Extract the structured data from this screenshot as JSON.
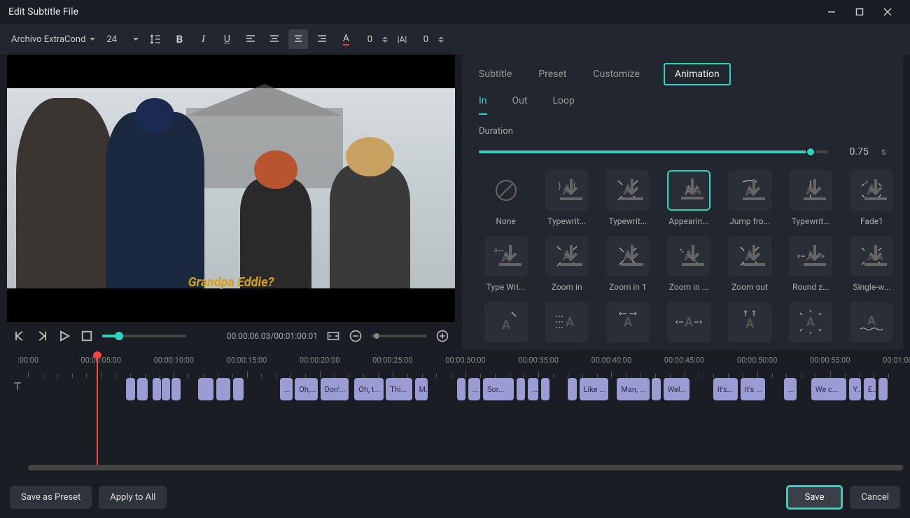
{
  "title": "Edit Subtitle File",
  "toolbar": {
    "font": "Archivo ExtraCond",
    "size": "24",
    "spacing1": "0",
    "spacing2": "0"
  },
  "subtitle_text": "Grandpa Eddie?",
  "timecode": "00:00:06:03/00:01:00:01",
  "tabs": [
    "Subtitle",
    "Preset",
    "Customize",
    "Animation"
  ],
  "active_tab": 3,
  "subtabs": [
    "In",
    "Out",
    "Loop"
  ],
  "active_subtab": 0,
  "duration_label": "Duration",
  "duration_value": "0.75",
  "duration_unit": "s",
  "anims": [
    {
      "label": "None"
    },
    {
      "label": "Typewrit..."
    },
    {
      "label": "Typewrit..."
    },
    {
      "label": "Appearin...",
      "selected": true
    },
    {
      "label": "Jump fro..."
    },
    {
      "label": "Typewrit..."
    },
    {
      "label": "Fade1"
    },
    {
      "label": "Type Wri..."
    },
    {
      "label": "Zoom in"
    },
    {
      "label": "Zoom in 1"
    },
    {
      "label": "Zoom in ..."
    },
    {
      "label": "Zoom out"
    },
    {
      "label": "Round z..."
    },
    {
      "label": "Single-w..."
    },
    {
      "label": ""
    },
    {
      "label": ""
    },
    {
      "label": ""
    },
    {
      "label": ""
    },
    {
      "label": ""
    },
    {
      "label": ""
    },
    {
      "label": ""
    }
  ],
  "ruler": [
    ":00:00",
    "00:00:05:00",
    "00:00:10:00",
    "00:00:15:00",
    "00:00:20:00",
    "00:00:25:00",
    "00:00:30:00",
    "00:00:35:00",
    "00:00:40:00",
    "00:00:45:00",
    "00:00:50:00",
    "00:00:55:00",
    "00:01:00:00"
  ],
  "clips": [
    {
      "left": 11.2,
      "width": 1.0,
      "text": ""
    },
    {
      "left": 12.5,
      "width": 1.2,
      "text": ""
    },
    {
      "left": 14.2,
      "width": 0.8,
      "text": ""
    },
    {
      "left": 15.3,
      "width": 0.8,
      "text": ""
    },
    {
      "left": 16.4,
      "width": 1.0,
      "text": ""
    },
    {
      "left": 19.4,
      "width": 1.8,
      "text": ""
    },
    {
      "left": 21.5,
      "width": 1.6,
      "text": ""
    },
    {
      "left": 23.4,
      "width": 1.2,
      "text": ""
    },
    {
      "left": 28.8,
      "width": 1.4,
      "text": "..."
    },
    {
      "left": 30.5,
      "width": 2.6,
      "text": "Oh,..."
    },
    {
      "left": 33.4,
      "width": 3.2,
      "text": "Don'..."
    },
    {
      "left": 37.3,
      "width": 3.3,
      "text": "Oh, t..."
    },
    {
      "left": 40.9,
      "width": 3.0,
      "text": "Thi..."
    },
    {
      "left": 44.2,
      "width": 1.5,
      "text": "M..."
    },
    {
      "left": 49.0,
      "width": 1.0,
      "text": ""
    },
    {
      "left": 50.3,
      "width": 1.4,
      "text": "..."
    },
    {
      "left": 52.0,
      "width": 3.5,
      "text": "Sor..."
    },
    {
      "left": 55.8,
      "width": 1.0,
      "text": ""
    },
    {
      "left": 57.1,
      "width": 1.2,
      "text": "..."
    },
    {
      "left": 58.6,
      "width": 1.0,
      "text": ""
    },
    {
      "left": 61.7,
      "width": 1.0,
      "text": ""
    },
    {
      "left": 63.0,
      "width": 3.3,
      "text": "Like ..."
    },
    {
      "left": 67.3,
      "width": 3.7,
      "text": "Man, ..."
    },
    {
      "left": 71.3,
      "width": 1.0,
      "text": ""
    },
    {
      "left": 72.6,
      "width": 3.0,
      "text": "Wel..."
    },
    {
      "left": 78.3,
      "width": 2.8,
      "text": "It's..."
    },
    {
      "left": 81.4,
      "width": 2.8,
      "text": "It's ..."
    },
    {
      "left": 86.4,
      "width": 1.4,
      "text": "..."
    },
    {
      "left": 89.5,
      "width": 4.0,
      "text": "We c..."
    },
    {
      "left": 93.8,
      "width": 1.4,
      "text": "Y..."
    },
    {
      "left": 95.5,
      "width": 1.4,
      "text": "E..."
    },
    {
      "left": 97.2,
      "width": 1.0,
      "text": ""
    }
  ],
  "footer": {
    "save_preset": "Save as Preset",
    "apply_all": "Apply to All",
    "save": "Save",
    "cancel": "Cancel"
  }
}
